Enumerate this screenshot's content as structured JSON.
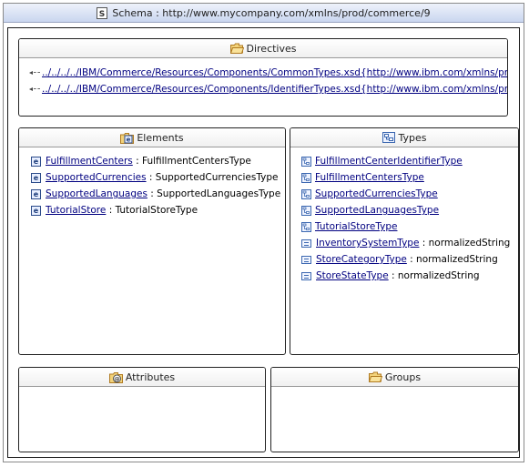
{
  "title": {
    "prefix": "Schema : ",
    "namespace": "http://www.mycompany.com/xmlns/prod/commerce/9"
  },
  "directives": {
    "header": "Directives",
    "items": [
      {
        "path": "../../../../IBM/Commerce/Resources/Components/CommonTypes.xsd",
        "namespace": "{http://www.ibm.com/xmlns/prod/com"
      },
      {
        "path": "../../../../IBM/Commerce/Resources/Components/IdentifierTypes.xsd",
        "namespace": "{http://www.ibm.com/xmlns/prod/con"
      }
    ]
  },
  "elements": {
    "header": "Elements",
    "items": [
      {
        "name": "FulfillmentCenters",
        "type": " : FulfillmentCentersType"
      },
      {
        "name": "SupportedCurrencies",
        "type": " : SupportedCurrenciesType"
      },
      {
        "name": "SupportedLanguages",
        "type": " : SupportedLanguagesType"
      },
      {
        "name": "TutorialStore",
        "type": " : TutorialStoreType"
      }
    ]
  },
  "types": {
    "header": "Types",
    "items": [
      {
        "kind": "complex",
        "name": "FulfillmentCenterIdentifierType",
        "base": ""
      },
      {
        "kind": "complex",
        "name": "FulfillmentCentersType",
        "base": ""
      },
      {
        "kind": "complex",
        "name": "SupportedCurrenciesType",
        "base": ""
      },
      {
        "kind": "complex",
        "name": "SupportedLanguagesType",
        "base": ""
      },
      {
        "kind": "complex",
        "name": "TutorialStoreType",
        "base": ""
      },
      {
        "kind": "simple",
        "name": "InventorySystemType",
        "base": " : normalizedString"
      },
      {
        "kind": "simple",
        "name": "StoreCategoryType",
        "base": " : normalizedString"
      },
      {
        "kind": "simple",
        "name": "StoreStateType",
        "base": " : normalizedString"
      }
    ]
  },
  "attributes": {
    "header": "Attributes"
  },
  "groups": {
    "header": "Groups"
  }
}
